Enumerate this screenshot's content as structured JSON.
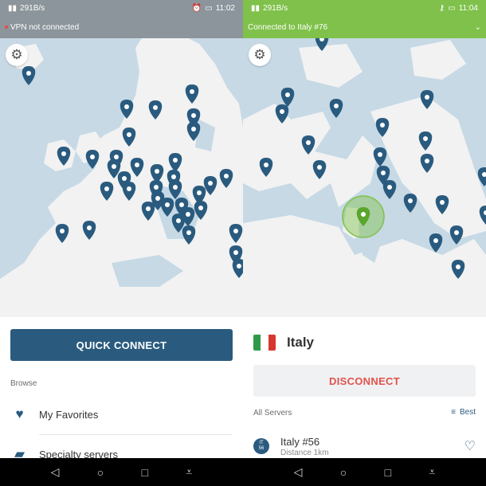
{
  "left": {
    "status": {
      "network": "291B/s",
      "time": "11:02"
    },
    "connection_text": "VPN not connected",
    "quick_connect_label": "QUICK CONNECT",
    "browse_label": "Browse",
    "menu": [
      {
        "label": "My Favorites",
        "icon": "heart-icon"
      },
      {
        "label": "Specialty servers",
        "icon": "star-folder-icon"
      }
    ]
  },
  "right": {
    "status": {
      "network": "291B/s",
      "time": "11:04"
    },
    "connection_text": "Connected to Italy #76",
    "country": "Italy",
    "disconnect_label": "DISCONNECT",
    "all_servers_label": "All Servers",
    "sort_label": "Best",
    "server": {
      "badge_top": "IT",
      "badge_bottom": "56",
      "name": "Italy #56",
      "distance": "Distance 1km"
    }
  },
  "colors": {
    "accent": "#2a5b7f",
    "connected": "#7fc14a",
    "disconnected_bar": "#8c959b",
    "disconnect_text": "#e0534e",
    "map_water": "#c6d9e5",
    "land": "#f2f2f2",
    "pin": "#2a5b7f",
    "active_pin": "#7fc14a"
  },
  "nav": [
    "back-icon",
    "home-icon",
    "recents-icon",
    "menu-down-icon"
  ]
}
